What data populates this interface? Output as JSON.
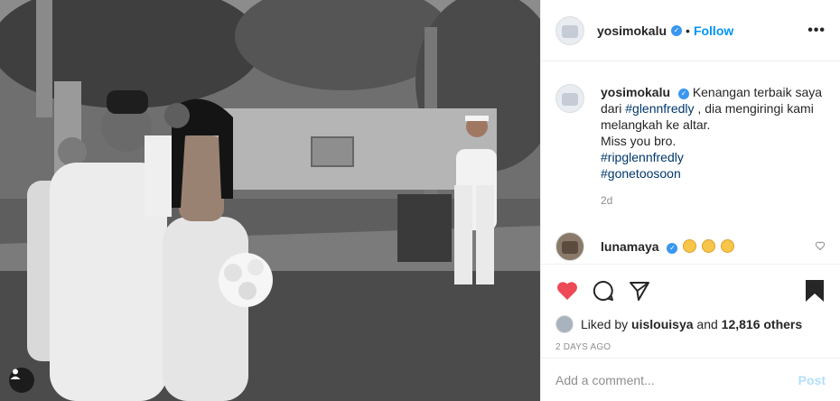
{
  "post": {
    "username": "yosimokalu",
    "follow_label": "Follow",
    "more_label": "•••",
    "verified_mark": "✓"
  },
  "caption": {
    "username": "yosimokalu",
    "text_1": "Kenangan terbaik saya dari",
    "tag_1": "#glennfredly",
    "text_2": ", dia mengiringi kami melangkah ke altar.",
    "line_2": "Miss you bro.",
    "tag_2": "#ripglennfredly",
    "tag_3": "#gonetoosoon",
    "time": "2d"
  },
  "comment": {
    "username": "lunamaya",
    "emoji_icon": "sad-face-emoji"
  },
  "likes": {
    "prefix": "Liked by",
    "liker": "uislouisya",
    "connector": "and",
    "count": "12,816 others"
  },
  "date": "2 DAYS AGO",
  "add_comment": {
    "placeholder": "Add a comment...",
    "post_label": "Post"
  },
  "colors": {
    "accent": "#0095f6",
    "like": "#ed4956",
    "tag": "#00376b",
    "muted": "#8e8e8e"
  }
}
